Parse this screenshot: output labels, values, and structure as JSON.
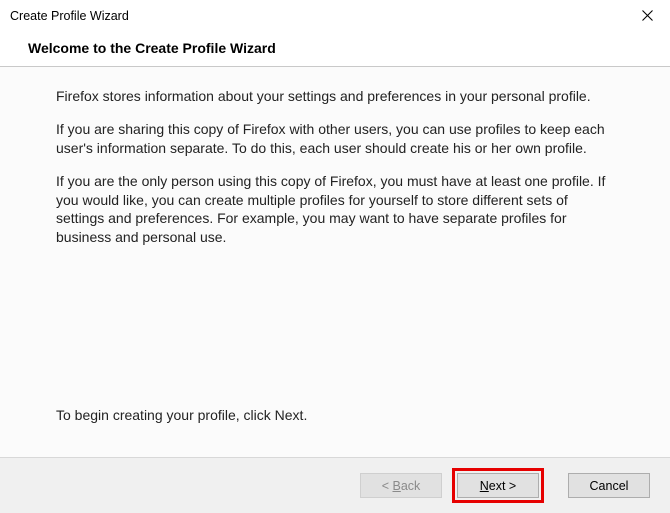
{
  "titlebar": {
    "title": "Create Profile Wizard"
  },
  "heading": "Welcome to the Create Profile Wizard",
  "paragraphs": {
    "p1": "Firefox stores information about your settings and preferences in your personal profile.",
    "p2": "If you are sharing this copy of Firefox with other users, you can use profiles to keep each user's information separate. To do this, each user should create his or her own profile.",
    "p3": "If you are the only person using this copy of Firefox, you must have at least one profile. If you would like, you can create multiple profiles for yourself to store different sets of settings and preferences. For example, you may want to have separate profiles for business and personal use.",
    "begin": "To begin creating your profile, click Next."
  },
  "buttons": {
    "back_prefix": "< ",
    "back_ul": "B",
    "back_rest": "ack",
    "next_ul": "N",
    "next_rest": "ext >",
    "cancel": "Cancel"
  }
}
